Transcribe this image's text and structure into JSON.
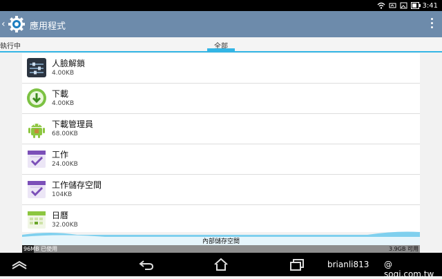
{
  "status_bar": {
    "time": "3:41",
    "icons": [
      "wifi-icon",
      "signal-icon",
      "image-icon",
      "battery-icon"
    ]
  },
  "action_bar": {
    "title": "應用程式",
    "icons": [
      "back-chevron-icon",
      "settings-gear-icon",
      "overflow-menu-icon"
    ]
  },
  "tabs": {
    "running": "執行中",
    "all": "全部",
    "selected": "all"
  },
  "apps": [
    {
      "name": "人臉解鎖",
      "size": "4.00KB",
      "icon": "face-unlock-icon"
    },
    {
      "name": "下載",
      "size": "4.00KB",
      "icon": "download-icon"
    },
    {
      "name": "下載管理員",
      "size": "68.00KB",
      "icon": "android-icon"
    },
    {
      "name": "工作",
      "size": "24.00KB",
      "icon": "tasks-icon"
    },
    {
      "name": "工作儲存空間",
      "size": "104KB",
      "icon": "tasks-icon"
    },
    {
      "name": "日曆",
      "size": "32.00KB",
      "icon": "calendar-icon"
    }
  ],
  "storage": {
    "label": "內部儲存空間",
    "used": "96MB 已使用",
    "free": "3.9GB 可用",
    "used_fraction": 0.03
  },
  "nav_bar": {
    "icons": [
      "recents-up-icon",
      "back-icon",
      "home-icon",
      "recent-apps-icon"
    ]
  },
  "watermark": {
    "user": "brianli813",
    "site": "@ sogi.com.tw"
  },
  "colors": {
    "action_bar": "#6d8bab",
    "accent": "#33b5e5",
    "background": "#f2f2f2"
  }
}
